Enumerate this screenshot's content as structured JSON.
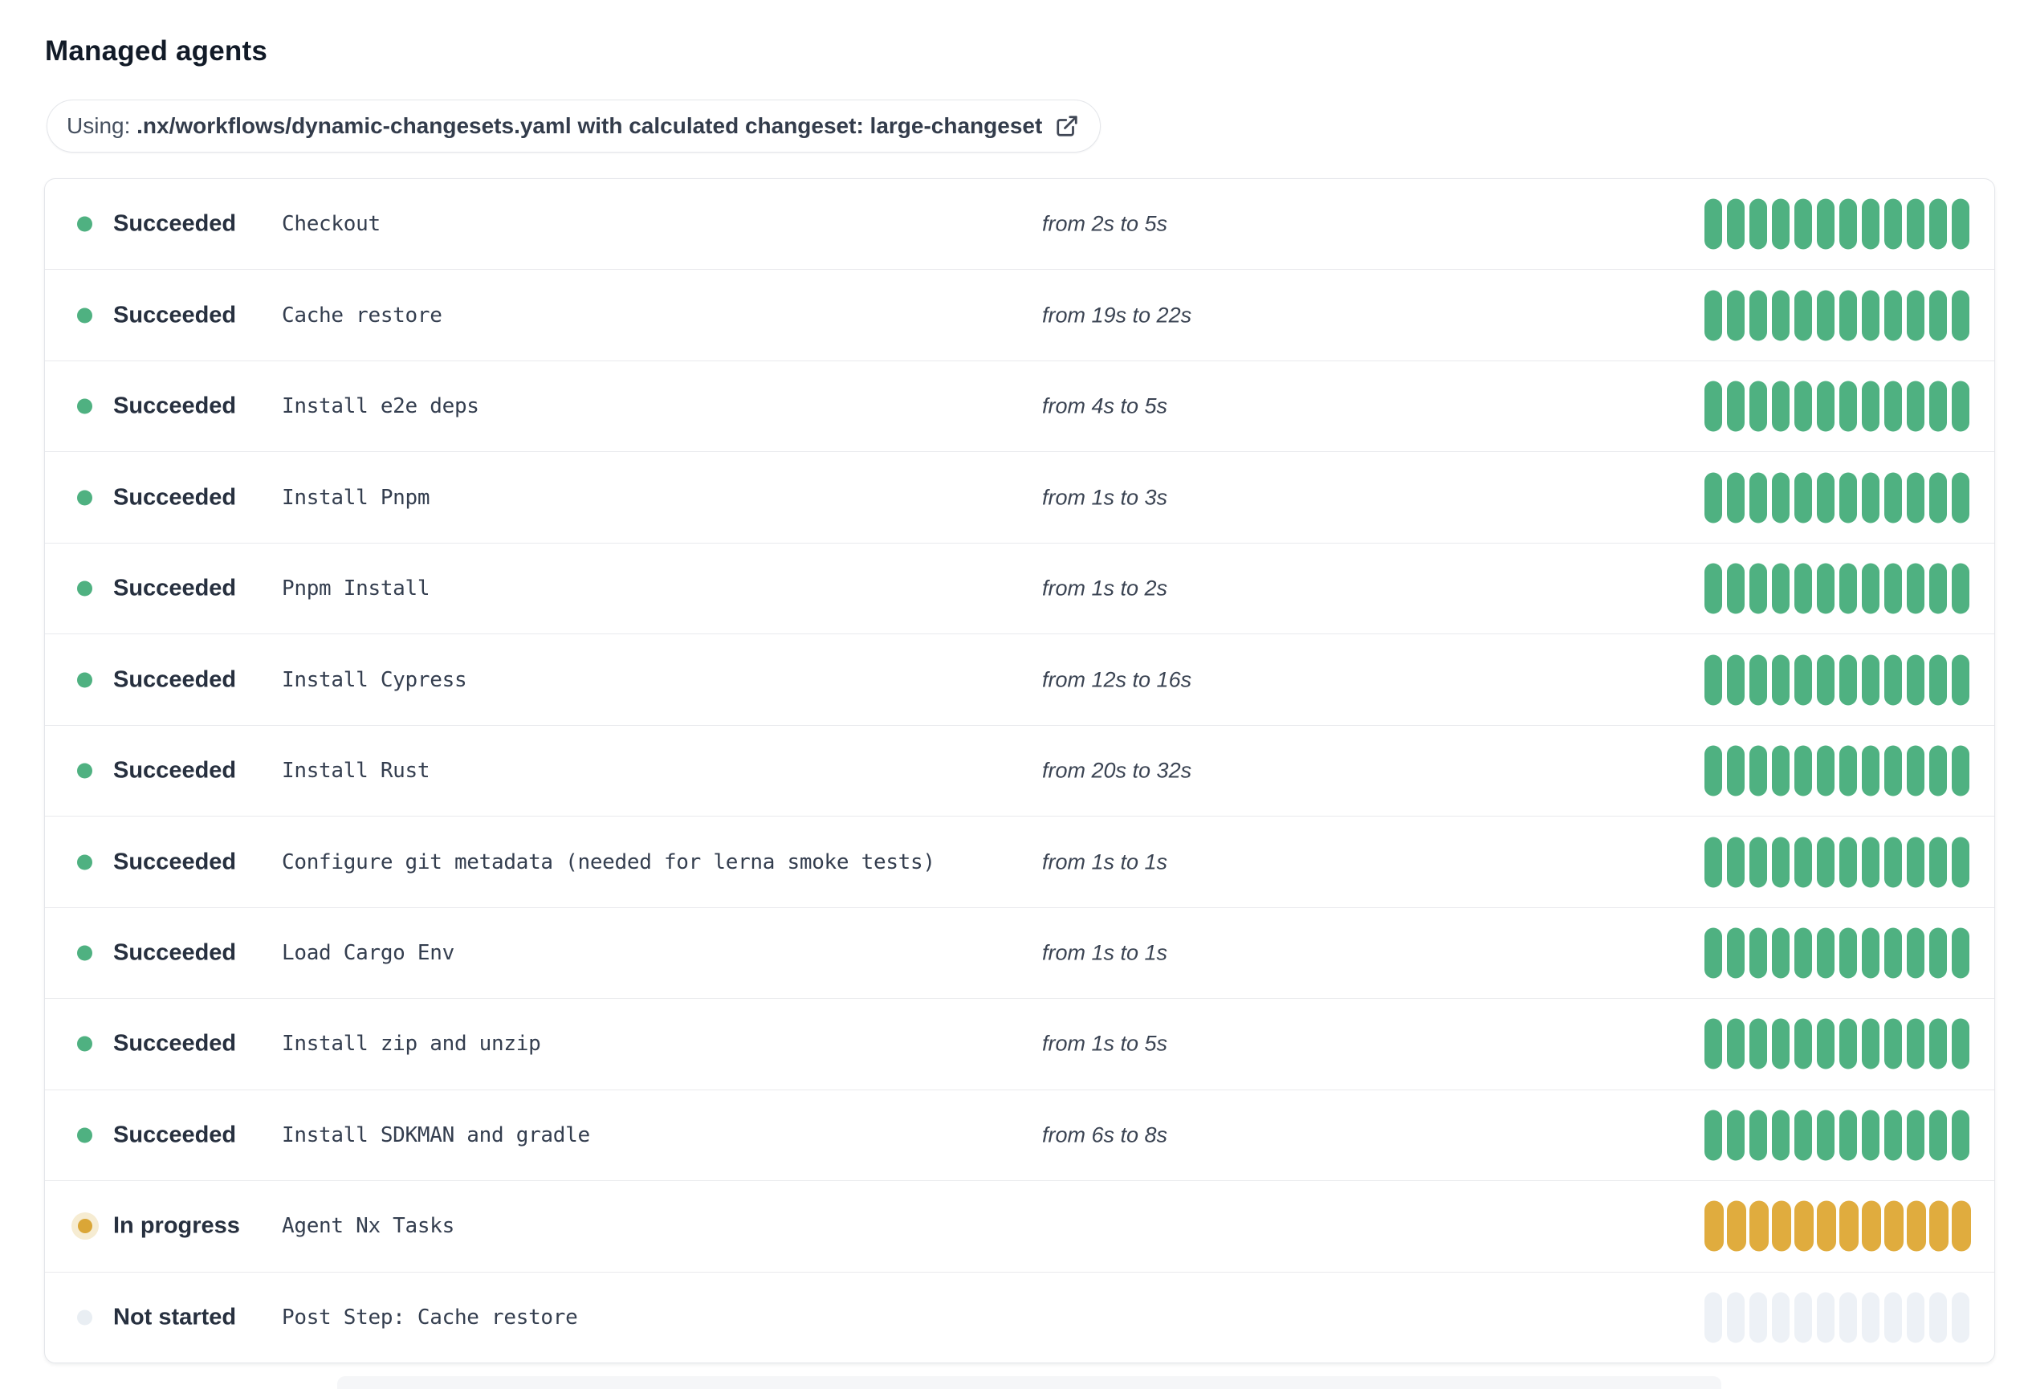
{
  "page": {
    "title": "Managed agents"
  },
  "banner": {
    "prefix": "Using: ",
    "details": ".nx/workflows/dynamic-changesets.yaml with calculated changeset: large-changeset",
    "icon": "external-link-icon"
  },
  "progress": {
    "segments_per_row": 12
  },
  "colors": {
    "success": "#4FB181",
    "inprogress": "#E0AC3E",
    "inprogress_dot": "#DAA637",
    "inprogress_halo": "#F6ECD2",
    "notstarted_pill": "#EDF1F6",
    "notstarted_dot": "#E9EEF3"
  },
  "steps": [
    {
      "status": "succeeded",
      "status_label": "Succeeded",
      "name": "Checkout",
      "duration": "from 2s to 5s"
    },
    {
      "status": "succeeded",
      "status_label": "Succeeded",
      "name": "Cache restore",
      "duration": "from 19s to 22s"
    },
    {
      "status": "succeeded",
      "status_label": "Succeeded",
      "name": "Install e2e deps",
      "duration": "from 4s to 5s"
    },
    {
      "status": "succeeded",
      "status_label": "Succeeded",
      "name": "Install Pnpm",
      "duration": "from 1s to 3s"
    },
    {
      "status": "succeeded",
      "status_label": "Succeeded",
      "name": "Pnpm Install",
      "duration": "from 1s to 2s"
    },
    {
      "status": "succeeded",
      "status_label": "Succeeded",
      "name": "Install Cypress",
      "duration": "from 12s to 16s"
    },
    {
      "status": "succeeded",
      "status_label": "Succeeded",
      "name": "Install Rust",
      "duration": "from 20s to 32s"
    },
    {
      "status": "succeeded",
      "status_label": "Succeeded",
      "name": "Configure git metadata (needed for lerna smoke tests)",
      "duration": "from 1s to 1s"
    },
    {
      "status": "succeeded",
      "status_label": "Succeeded",
      "name": "Load Cargo Env",
      "duration": "from 1s to 1s"
    },
    {
      "status": "succeeded",
      "status_label": "Succeeded",
      "name": "Install zip and unzip",
      "duration": "from 1s to 5s"
    },
    {
      "status": "succeeded",
      "status_label": "Succeeded",
      "name": "Install SDKMAN and gradle",
      "duration": "from 6s to 8s"
    },
    {
      "status": "in_progress",
      "status_label": "In progress",
      "name": "Agent Nx Tasks",
      "duration": ""
    },
    {
      "status": "not_started",
      "status_label": "Not started",
      "name": "Post Step: Cache restore",
      "duration": ""
    }
  ]
}
